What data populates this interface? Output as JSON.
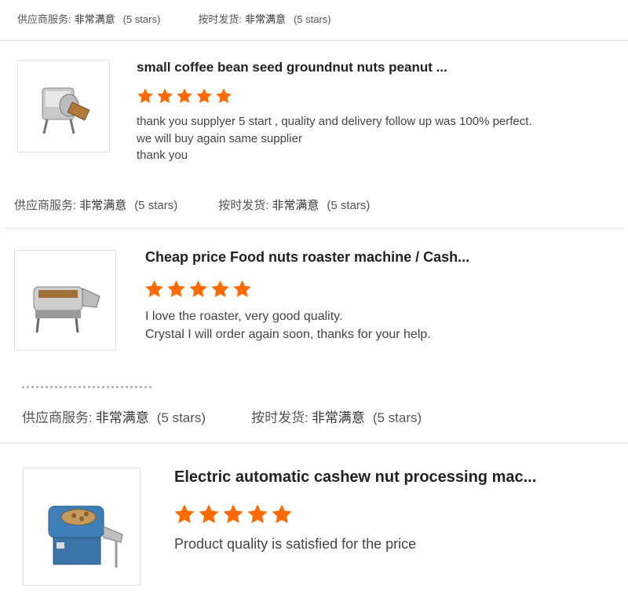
{
  "colors": {
    "star": "#ff6a00",
    "divider": "#e4e4e4"
  },
  "rating_labels": {
    "supplier_service": "供应商服务:",
    "on_time_delivery": "按时发货:",
    "value": "非常满意",
    "stars": "(5 stars)"
  },
  "top_ratings": {
    "stars_count": 5
  },
  "reviews": [
    {
      "image_icon": "coffee-roaster-drum-icon",
      "title": "small coffee bean seed groundnut nuts peanut ...",
      "stars": 5,
      "lines": [
        "thank you supplyer 5 start , quality and delivery follow up was 100% perfect.",
        "we will buy again same supplier",
        "thank you"
      ]
    },
    {
      "image_icon": "nut-roaster-machine-icon",
      "title": "Cheap price Food nuts roaster machine / Cash...",
      "stars": 5,
      "lines": [
        "I love the roaster, very good quality.",
        "Crystal I will order again soon, thanks for your help."
      ]
    },
    {
      "image_icon": "cashew-processing-machine-icon",
      "title": "Electric automatic cashew nut processing mac...",
      "stars": 5,
      "lines": [
        "Product quality is satisfied for the price"
      ]
    }
  ]
}
